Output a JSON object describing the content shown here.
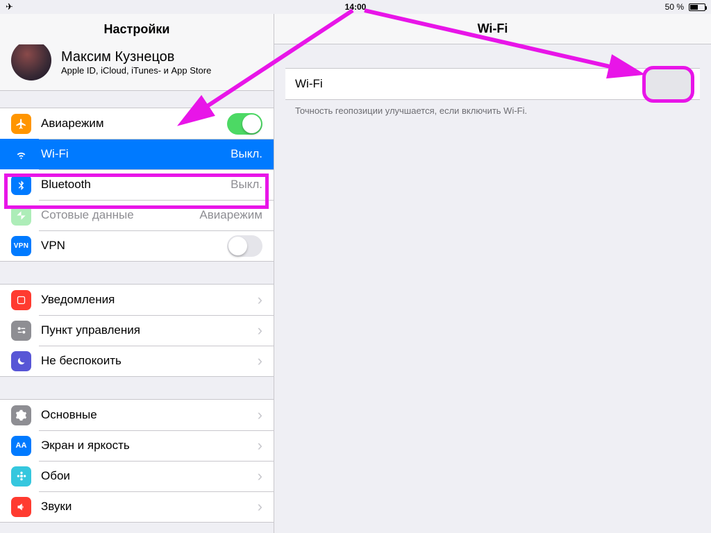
{
  "statusbar": {
    "time": "14:00",
    "battery_label": "50 %"
  },
  "header": {
    "left_title": "Настройки",
    "right_title": "Wi-Fi"
  },
  "apple_id": {
    "name": "Максим Кузнецов",
    "subtitle": "Apple ID, iCloud, iTunes- и App Store"
  },
  "rows": {
    "airplane": "Авиарежим",
    "wifi": "Wi-Fi",
    "wifi_status": "Выкл.",
    "bluetooth": "Bluetooth",
    "bluetooth_status": "Выкл.",
    "cellular": "Сотовые данные",
    "cellular_status": "Авиарежим",
    "vpn": "VPN",
    "vpn_text": "VPN",
    "notifications": "Уведомления",
    "control_center": "Пункт управления",
    "dnd": "Не беспокоить",
    "general": "Основные",
    "display": "Экран и яркость",
    "display_glyph": "AA",
    "wallpaper": "Обои",
    "sounds": "Звуки"
  },
  "detail": {
    "wifi_label": "Wi-Fi",
    "footer": "Точность геопозиции улучшается, если включить Wi-Fi."
  },
  "toggles": {
    "airplane": true,
    "vpn": false,
    "wifi_detail": false
  }
}
